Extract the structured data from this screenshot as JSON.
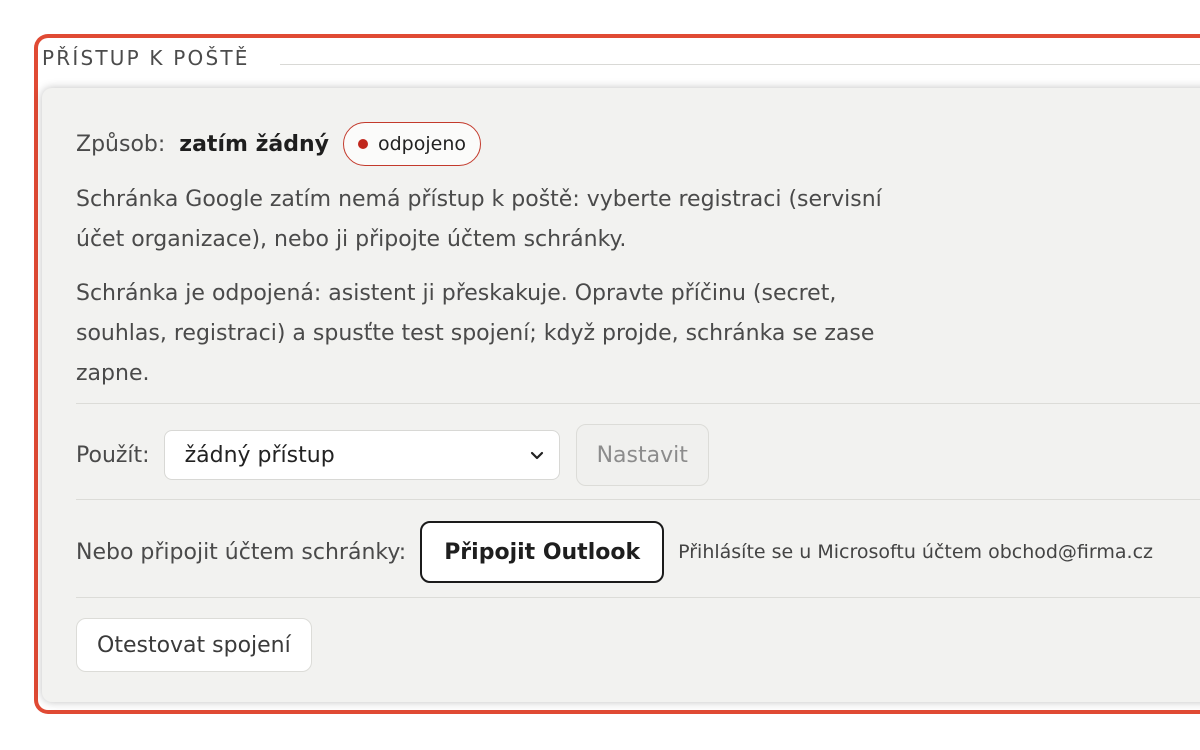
{
  "section": {
    "title": "PŘÍSTUP K POŠTĚ"
  },
  "method": {
    "label": "Způsob:",
    "value": "zatím žádný",
    "status": "odpojeno"
  },
  "notes": [
    "Schránka Google zatím nemá přístup k poště: vyberte registraci (servisní účet organizace), nebo ji připojte účtem schránky.",
    "Schránka je odpojená: asistent ji přeskakuje. Opravte příčinu (secret, souhlas, registraci) a spusťte test spojení; když projde, schránka se zase zapne."
  ],
  "use": {
    "label": "Použít:",
    "selected": "žádný přístup",
    "set_button": "Nastavit"
  },
  "connect": {
    "label": "Nebo připojit účtem schránky:",
    "button": "Připojit Outlook",
    "hint": "Přihlásíte se u Microsoftu účtem obchod@firma.cz"
  },
  "test": {
    "button": "Otestovat spojení"
  },
  "colors": {
    "accent_border": "#e04a34",
    "status_red": "#c0271d",
    "panel_bg": "#f2f2f0"
  }
}
